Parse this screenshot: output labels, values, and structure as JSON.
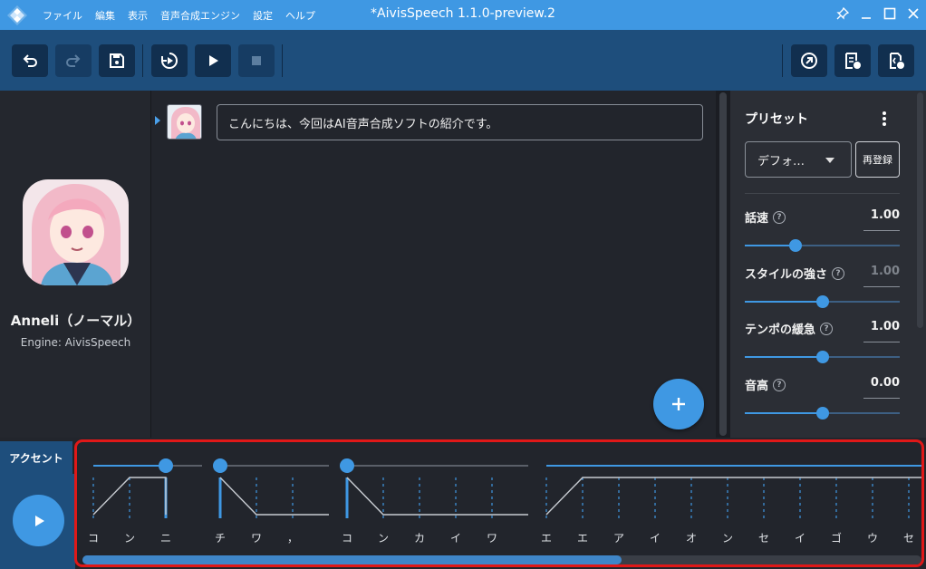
{
  "window": {
    "title": "*AivisSpeech 1.1.0-preview.2",
    "menu": [
      "ファイル",
      "編集",
      "表示",
      "音声合成エンジン",
      "設定",
      "ヘルプ"
    ]
  },
  "toolbar": {
    "left_icons": [
      "undo-icon",
      "redo-icon",
      "save-icon",
      "play-continuous-icon",
      "play-icon",
      "stop-icon"
    ],
    "right_icons": [
      "export-icon",
      "export-text-icon",
      "export-audio-icon"
    ]
  },
  "character": {
    "name": "Anneli（ノーマル）",
    "engine": "Engine: AivisSpeech"
  },
  "editor": {
    "rows": [
      {
        "text": "こんにちは、今回はAI音声合成ソフトの紹介です。"
      }
    ],
    "add_button_icon": "plus-icon"
  },
  "preset": {
    "title": "プリセット",
    "selected": "デフォ…",
    "reregister": "再登録"
  },
  "params": [
    {
      "label": "話速",
      "value": "1.00",
      "level": 0.33,
      "dim": false
    },
    {
      "label": "スタイルの強さ",
      "value": "1.00",
      "level": 0.5,
      "dim": true
    },
    {
      "label": "テンポの緩急",
      "value": "1.00",
      "level": 0.5,
      "dim": false
    },
    {
      "label": "音高",
      "value": "0.00",
      "level": 0.5,
      "dim": false
    }
  ],
  "bottom": {
    "tab": "アクセント",
    "play_icon": "play-icon"
  },
  "accent_phrases": [
    {
      "moras": [
        "コ",
        "ン",
        "ニ"
      ],
      "accent": 3
    },
    {
      "moras": [
        "チ",
        "ワ",
        "，"
      ],
      "accent": 1
    },
    {
      "moras": [
        "コ",
        "ン",
        "カ",
        "イ",
        "ワ"
      ],
      "accent": 1
    },
    {
      "moras": [
        "エ",
        "エ",
        "ア",
        "イ",
        "オ",
        "ン",
        "セ",
        "イ",
        "ゴ",
        "ウ",
        "セ"
      ],
      "accent": 0
    }
  ],
  "colors": {
    "accent": "#3f98e3",
    "toolbar": "#1e4e7c",
    "highlight_frame": "#e01818"
  }
}
